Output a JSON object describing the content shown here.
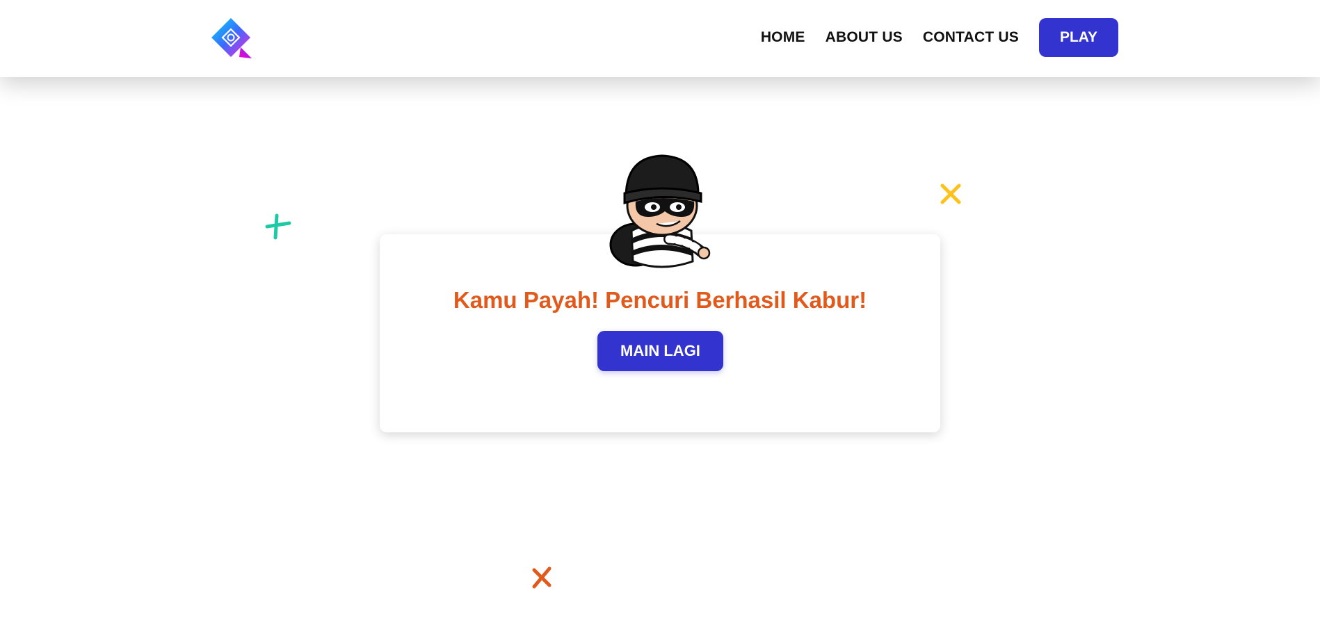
{
  "header": {
    "logo_icon": "diamond-logo-icon",
    "nav": [
      {
        "label": "HOME"
      },
      {
        "label": "ABOUT US"
      },
      {
        "label": "CONTACT US"
      }
    ],
    "play_label": "PLAY"
  },
  "main": {
    "image_icon": "thief-illustration",
    "title": "Kamu Payah! Pencuri Berhasil Kabur!",
    "button_label": "MAIN LAGI"
  },
  "colors": {
    "accent": "#3333cf",
    "title": "#e15a1c",
    "deco_green": "#1ec9a5",
    "deco_yellow": "#ffc21a",
    "deco_orange": "#e15a1c"
  }
}
